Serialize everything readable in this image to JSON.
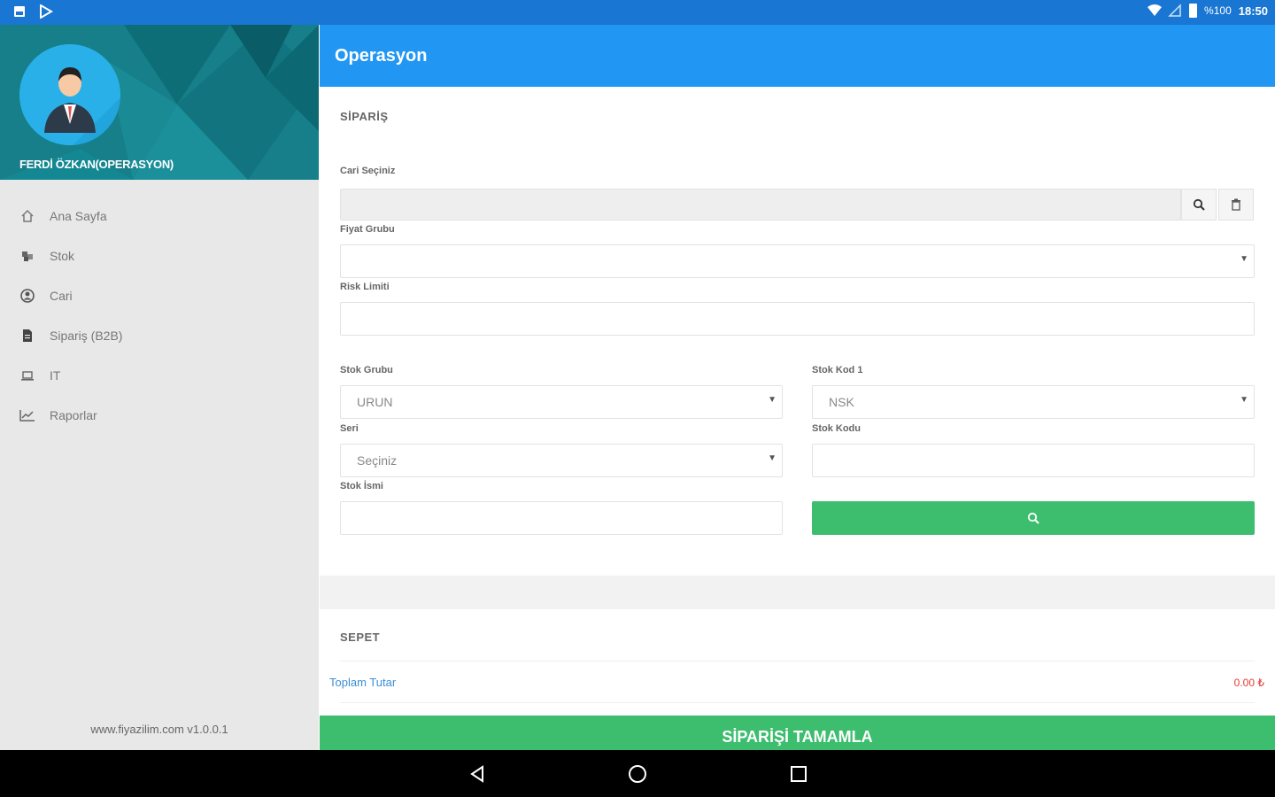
{
  "status_bar": {
    "battery": "%100",
    "time": "18:50"
  },
  "sidebar": {
    "user_name": "FERDİ ÖZKAN(OPERASYON)",
    "items": [
      {
        "label": "Ana Sayfa",
        "icon": "home-icon"
      },
      {
        "label": "Stok",
        "icon": "cubes-icon"
      },
      {
        "label": "Cari",
        "icon": "user-circle-icon"
      },
      {
        "label": "Sipariş (B2B)",
        "icon": "file-icon"
      },
      {
        "label": "IT",
        "icon": "laptop-icon"
      },
      {
        "label": "Raporlar",
        "icon": "line-chart-icon"
      }
    ],
    "footer": "www.fiyazilim.com v1.0.0.1"
  },
  "appbar": {
    "title": "Operasyon"
  },
  "order": {
    "section_title": "SİPARİŞ",
    "cari_label": "Cari Seçiniz",
    "cari_value": "",
    "fiyat_label": "Fiyat Grubu",
    "fiyat_value": "",
    "risk_label": "Risk Limiti",
    "risk_value": "",
    "stok_grubu_label": "Stok Grubu",
    "stok_grubu_value": "URUN",
    "stok_kod1_label": "Stok Kod 1",
    "stok_kod1_value": "NSK",
    "seri_label": "Seri",
    "seri_value": "Seçiniz",
    "stok_kodu_label": "Stok Kodu",
    "stok_kodu_value": "",
    "stok_ismi_label": "Stok İsmi",
    "stok_ismi_value": ""
  },
  "cart": {
    "section_title": "SEPET",
    "total_label": "Toplam Tutar",
    "total_value": "0.00 ₺"
  },
  "complete_button": "SİPARİŞİ TAMAMLA",
  "colors": {
    "status_bar": "#1976D2",
    "appbar": "#2196F3",
    "green": "#3dbd6e",
    "sidebar_header": "#167f8a"
  }
}
